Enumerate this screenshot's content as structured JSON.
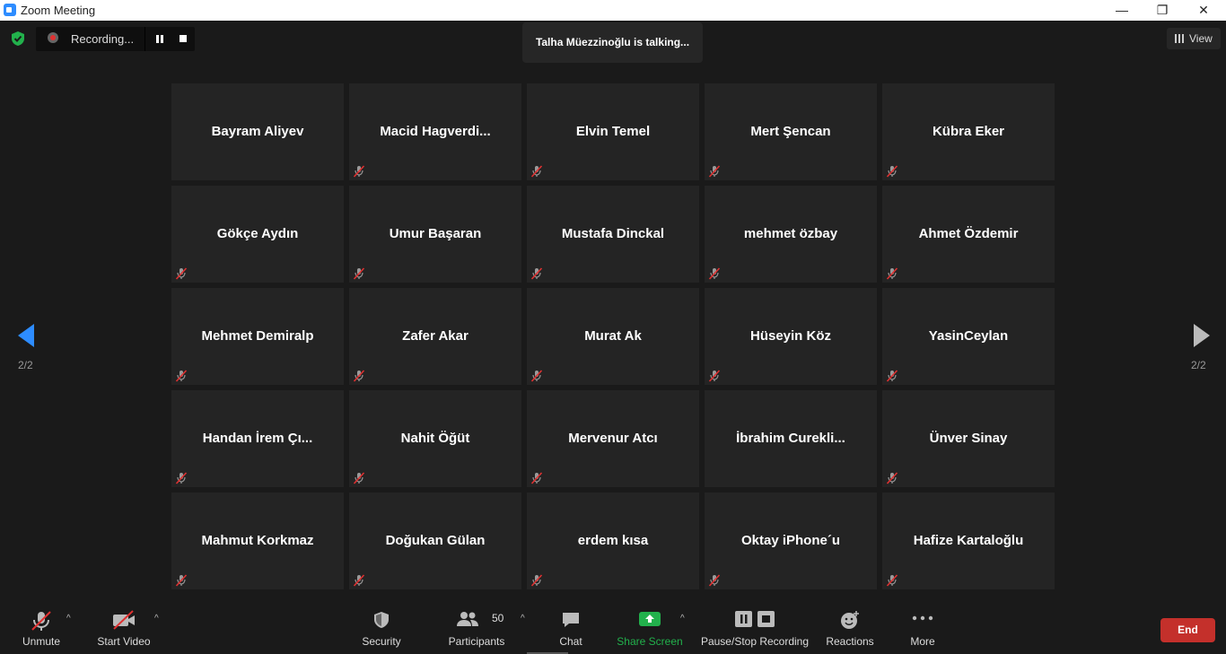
{
  "window": {
    "title": "Zoom Meeting",
    "minimize": "—",
    "restore": "❐",
    "close": "✕"
  },
  "recording": {
    "label": "Recording..."
  },
  "toast": {
    "text": "Talha Müezzinoğlu is talking..."
  },
  "view": {
    "label": "View"
  },
  "pager": {
    "left": "2/2",
    "right": "2/2"
  },
  "participants": [
    {
      "name": "Bayram Aliyev",
      "muted": false
    },
    {
      "name": "Macid  Hagverdi...",
      "muted": true
    },
    {
      "name": "Elvin Temel",
      "muted": true
    },
    {
      "name": "Mert Şencan",
      "muted": true
    },
    {
      "name": "Kübra Eker",
      "muted": true
    },
    {
      "name": "Gökçe Aydın",
      "muted": true
    },
    {
      "name": "Umur Başaran",
      "muted": true
    },
    {
      "name": "Mustafa Dinckal",
      "muted": true
    },
    {
      "name": "mehmet özbay",
      "muted": true
    },
    {
      "name": "Ahmet Özdemir",
      "muted": true
    },
    {
      "name": "Mehmet Demiralp",
      "muted": true
    },
    {
      "name": "Zafer Akar",
      "muted": true
    },
    {
      "name": "Murat Ak",
      "muted": true
    },
    {
      "name": "Hüseyin Köz",
      "muted": true
    },
    {
      "name": "YasinCeylan",
      "muted": true
    },
    {
      "name": "Handan  İrem  Çı...",
      "muted": true
    },
    {
      "name": "Nahit Öğüt",
      "muted": true
    },
    {
      "name": "Mervenur Atcı",
      "muted": true
    },
    {
      "name": "İbrahim  Curekli...",
      "muted": false
    },
    {
      "name": "Ünver Sinay",
      "muted": true
    },
    {
      "name": "Mahmut Korkmaz",
      "muted": true
    },
    {
      "name": "Doğukan Gülan",
      "muted": true
    },
    {
      "name": "erdem kısa",
      "muted": true
    },
    {
      "name": "Oktay iPhone´u",
      "muted": true
    },
    {
      "name": "Hafize Kartaloğlu",
      "muted": true
    }
  ],
  "toolbar": {
    "unmute": "Unmute",
    "start_video": "Start Video",
    "security": "Security",
    "participants": "Participants",
    "participants_count": "50",
    "chat": "Chat",
    "share_screen": "Share Screen",
    "pause_stop": "Pause/Stop Recording",
    "reactions": "Reactions",
    "more": "More",
    "end": "End"
  },
  "colors": {
    "accent": "#2d8cff",
    "share": "#22b14c",
    "end": "#c4302b",
    "mute": "#e03131"
  }
}
